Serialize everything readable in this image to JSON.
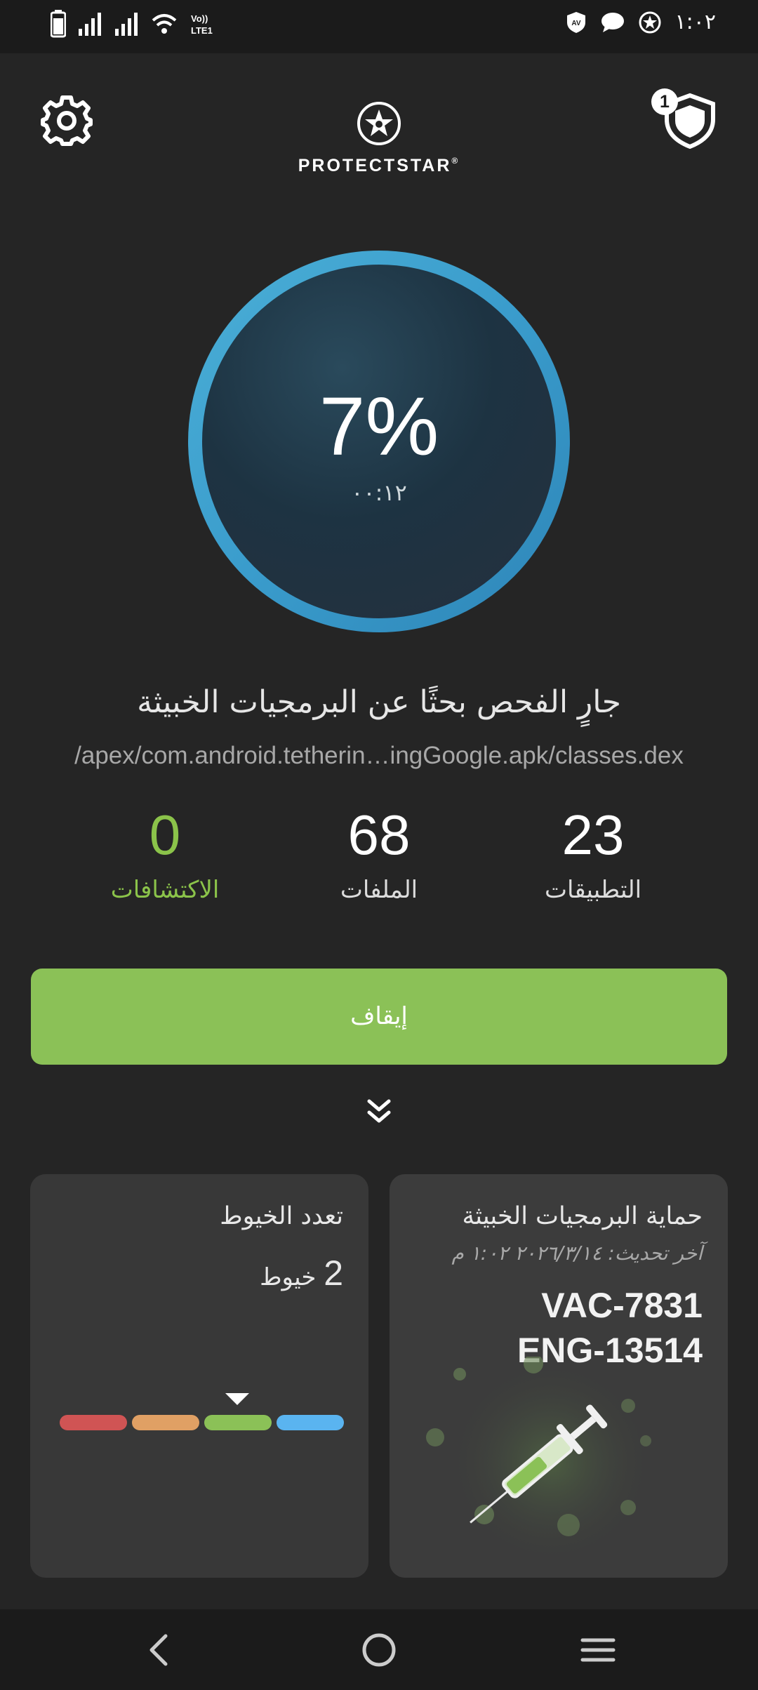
{
  "status_bar": {
    "time": "١:٠٢",
    "left_icons": [
      "battery-icon",
      "signal-icon",
      "signal-icon",
      "wifi-icon",
      "volte-icon"
    ],
    "right_icons": [
      "av-icon",
      "chat-icon",
      "protectstar-icon"
    ]
  },
  "header": {
    "brand": "PROTECTSTAR",
    "trademark": "®",
    "notification_count": "1"
  },
  "scan": {
    "percent": "7%",
    "progress": 0.07,
    "elapsed": "٠٠:١٢",
    "title": "جارٍ الفحص بحثًا عن البرمجيات الخبيثة",
    "path": "/apex/com.android.tetherin…ingGoogle.apk/classes.dex"
  },
  "stats": {
    "apps_count": "23",
    "apps_label": "التطبيقات",
    "files_count": "68",
    "files_label": "الملفات",
    "detections_count": "0",
    "detections_label": "الاكتشافات"
  },
  "stop_button_label": "إيقاف",
  "cards": {
    "malware": {
      "title": "حماية البرمجيات الخبيثة",
      "last_update": "آخر تحديث: ٢٠٢٦/٣/١٤ ١:٠٢ م",
      "vac": "VAC-7831",
      "eng": "ENG-13514"
    },
    "threads": {
      "title": "تعدد الخيوط",
      "count": "2",
      "unit": "خيوط",
      "segment_colors": [
        "#d05454",
        "#e0a064",
        "#8bc157",
        "#5ab4f0"
      ],
      "selected_segment": 3
    }
  },
  "colors": {
    "accent_green": "#8bc157",
    "ring_blue": "#3a9ccc",
    "background": "#252525"
  }
}
